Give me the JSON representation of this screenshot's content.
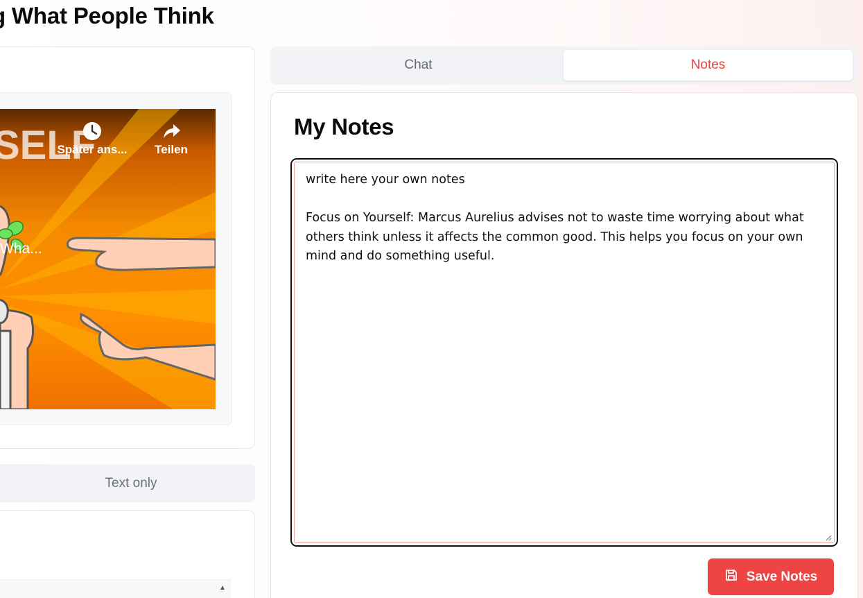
{
  "page": {
    "title": "g What People Think"
  },
  "video": {
    "title": "Wha...",
    "overlay_text": "SELF",
    "actions": [
      {
        "label": "Später ans...",
        "icon": "clock-icon"
      },
      {
        "label": "Teilen",
        "icon": "share-icon"
      }
    ]
  },
  "left_tabs": {
    "text_only": "Text only"
  },
  "right_tabs": {
    "chat": "Chat",
    "notes": "Notes",
    "active": "Notes"
  },
  "notes": {
    "heading": "My Notes",
    "content": "write here your own notes\n\nFocus on Yourself: Marcus Aurelius advises not to waste time worrying about what others think unless it affects the common good. This helps you focus on your own mind and do something useful.",
    "save_label": "Save Notes",
    "save_icon": "save-icon"
  },
  "colors": {
    "accent": "#ef4444",
    "active_tab_text": "#e5413f",
    "tab_bg": "#f1f3f7"
  }
}
